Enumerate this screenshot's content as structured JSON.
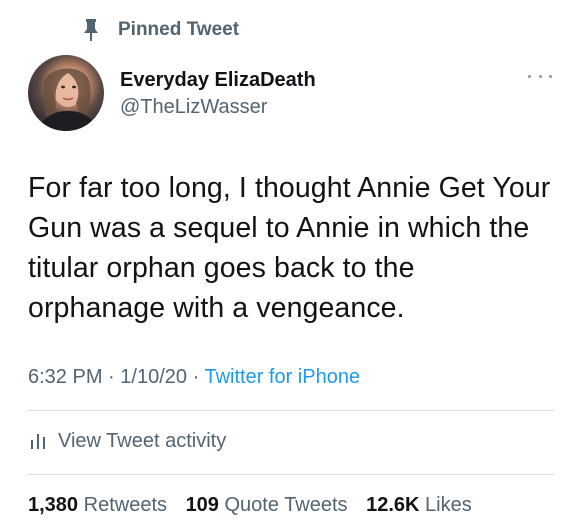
{
  "pinned_label": "Pinned Tweet",
  "author": {
    "display_name": "Everyday ElizaDeath",
    "handle": "@TheLizWasser"
  },
  "tweet": {
    "text": "For far too long, I thought Annie Get Your Gun was a sequel to Annie in which the titular orphan goes back to the orphanage with a vengeance.",
    "time": "6:32 PM",
    "date": "1/10/20",
    "source": "Twitter for iPhone",
    "separator": "·"
  },
  "activity_label": "View Tweet activity",
  "stats": {
    "retweets": {
      "count": "1,380",
      "label": "Retweets"
    },
    "quotes": {
      "count": "109",
      "label": "Quote Tweets"
    },
    "likes": {
      "count": "12.6K",
      "label": "Likes"
    }
  },
  "icons": {
    "pin": "pin-icon",
    "more": "more-icon",
    "activity": "bar-chart-icon"
  },
  "colors": {
    "text": "#0f1419",
    "secondary": "#536471",
    "link": "#1d9bf0",
    "divider": "#d9dee2"
  }
}
